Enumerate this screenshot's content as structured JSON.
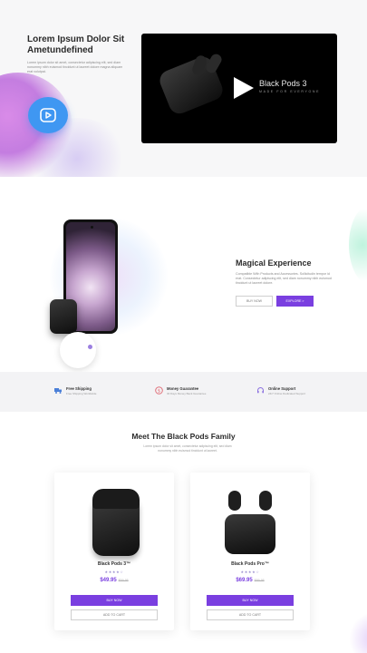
{
  "hero": {
    "title": "Lorem Ipsum Dolor Sit Ametundefined",
    "text": "Lorem ipsum dolor sit amet, consectetur adipiscing elit, sed diam nonummy nibh euismod tincidunt ut laoreet dolore magna aliquam erat volutpat.",
    "video_title": "Black Pods 3",
    "video_subtitle": "MADE FOR EVERYONE",
    "accent": "#3f97f2"
  },
  "feature_section": {
    "title": "Magical Experience",
    "text": "Compatible With Products and Accessories. Sollicitudin tempor id erat. Consectetur adipiscing elit, sed diam nonummy nibh euismod tincidunt ut laoreet dolore.",
    "button_secondary": "BUY NOW",
    "button_primary": "EXPLORE  >"
  },
  "features": [
    {
      "icon": "truck-icon",
      "title": "Free Shipping",
      "subtitle": "Free Shipping Worldwide"
    },
    {
      "icon": "money-icon",
      "title": "Money Guarantee",
      "subtitle": "30 Days Money Back Guarantee"
    },
    {
      "icon": "headset-icon",
      "title": "Online Support",
      "subtitle": "24/7 Online Dedicated Support"
    }
  ],
  "products_section": {
    "title": "Meet The Black Pods Family",
    "subtitle": "Lorem ipsum dolor sit amet, consectetur adipiscing elit, sed diam nonummy nibh euismod tincidunt ut laoreet.",
    "accent": "#7a3fe0"
  },
  "products": [
    {
      "name": "Black Pods 3™",
      "stars": "★★★★☆",
      "price": "$49.95",
      "old_price": "$59.95",
      "buy": "BUY NOW",
      "cart": "ADD TO CART"
    },
    {
      "name": "Black Pods Pro™",
      "stars": "★★★★☆",
      "price": "$69.95",
      "old_price": "$89.95",
      "buy": "BUY NOW",
      "cart": "ADD TO CART"
    }
  ]
}
